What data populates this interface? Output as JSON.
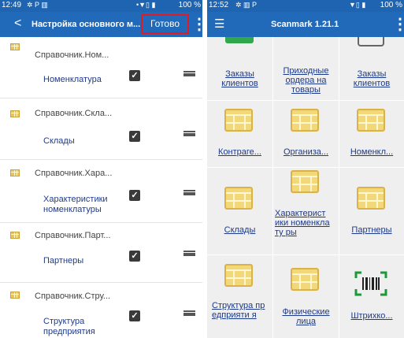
{
  "left": {
    "status": {
      "time": "12:49",
      "icons": "✲ P ▥",
      "right_icons": "•▼▯ ▮",
      "battery": "100 %"
    },
    "appbar": {
      "back": "<",
      "title": "Настройка основного м...",
      "done": "Готово",
      "menu": "⋮"
    },
    "rows": [
      {
        "ref": "Справочник.Ном...",
        "name": "Номенклатура"
      },
      {
        "ref": "Справочник.Скла...",
        "name": "Склады"
      },
      {
        "ref": "Справочник.Хара...",
        "name": "Характеристики номенклатуры"
      },
      {
        "ref": "Справочник.Парт...",
        "name": "Партнеры"
      },
      {
        "ref": "Справочник.Стру...",
        "name": "Структура предприятия"
      }
    ],
    "check_glyph": "✓"
  },
  "right": {
    "status": {
      "time": "12:52",
      "icons": "✲ ▥ P",
      "right_icons": "▼▯ ▮",
      "battery": "100 %"
    },
    "appbar": {
      "hamburger": "☰",
      "title": "Scanmark 1.21.1",
      "menu": "⋮"
    },
    "tiles": [
      {
        "label": "Заказы клиентов",
        "icon": "green-icon"
      },
      {
        "label": "Приходные ордера на товары",
        "icon": "none"
      },
      {
        "label": "Заказы клиентов",
        "icon": "doc-icon"
      },
      {
        "label": "Контраге...",
        "icon": "table-icon"
      },
      {
        "label": "Организа...",
        "icon": "table-icon"
      },
      {
        "label": "Номенкл...",
        "icon": "table-icon"
      },
      {
        "label": "Склады",
        "icon": "table-icon"
      },
      {
        "label": "Характерист ики номенклату ры",
        "icon": "table-icon"
      },
      {
        "label": "Партнеры",
        "icon": "table-icon"
      },
      {
        "label": "Структура предприяти я",
        "icon": "table-icon"
      },
      {
        "label": "Физические лица",
        "icon": "table-icon"
      },
      {
        "label": "Штрихко...",
        "icon": "barcode-icon"
      }
    ]
  },
  "colors": {
    "bar": "#2169b9",
    "status": "#1e64b0",
    "link": "#1d3a8a",
    "icon_fill": "#f3d87a",
    "highlight": "#e01b24",
    "barcode": "#1c9a3a"
  }
}
